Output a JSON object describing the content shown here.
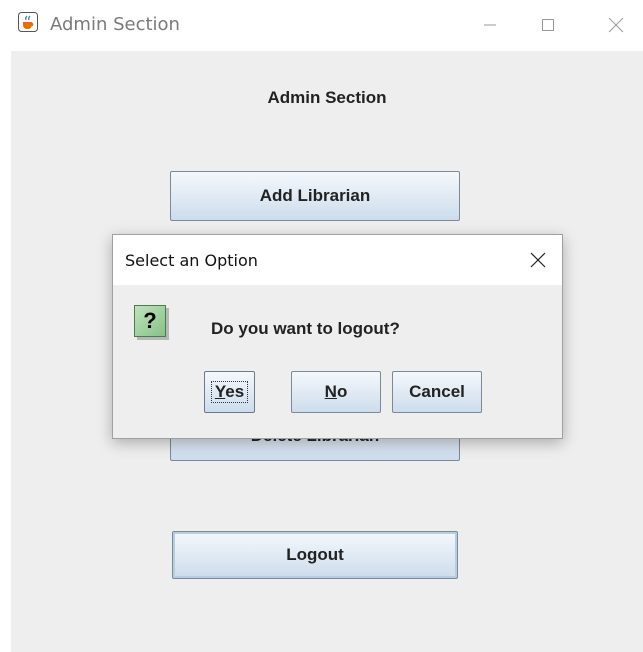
{
  "window": {
    "title": "Admin Section",
    "icon": "java-cup-icon"
  },
  "main": {
    "heading": "Admin Section",
    "add_librarian": "Add Librarian",
    "delete_librarian": "Delete Librarian",
    "logout": "Logout"
  },
  "dialog": {
    "title": "Select an Option",
    "message": "Do you want to logout?",
    "icon": "question-icon",
    "yes_mnemonic": "Y",
    "yes_rest": "es",
    "no_mnemonic": "N",
    "no_rest": "o",
    "cancel": "Cancel"
  },
  "colors": {
    "button_gradient_top": "#f4f8fc",
    "button_gradient_bottom": "#ccdcec",
    "question_icon": "#86c186"
  }
}
